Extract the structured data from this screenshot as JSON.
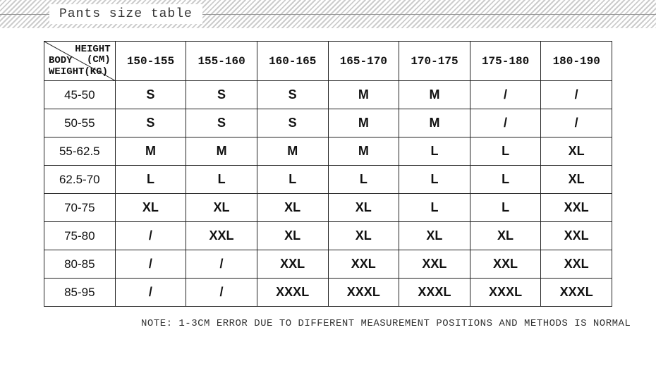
{
  "title": "Pants size table",
  "corner": {
    "top1": "HEIGHT",
    "top2": "(CM)",
    "bot1": "BODY",
    "bot2": "WEIGHT(KG)"
  },
  "chart_data": {
    "type": "table",
    "title": "Pants size table",
    "xlabel": "HEIGHT (CM)",
    "ylabel": "BODY WEIGHT (KG)",
    "categories": [
      "150-155",
      "155-160",
      "160-165",
      "165-170",
      "170-175",
      "175-180",
      "180-190"
    ],
    "rows": [
      {
        "label": "45-50",
        "values": [
          "S",
          "S",
          "S",
          "M",
          "M",
          "/",
          "/"
        ]
      },
      {
        "label": "50-55",
        "values": [
          "S",
          "S",
          "S",
          "M",
          "M",
          "/",
          "/"
        ]
      },
      {
        "label": "55-62.5",
        "values": [
          "M",
          "M",
          "M",
          "M",
          "L",
          "L",
          "XL"
        ]
      },
      {
        "label": "62.5-70",
        "values": [
          "L",
          "L",
          "L",
          "L",
          "L",
          "L",
          "XL"
        ]
      },
      {
        "label": "70-75",
        "values": [
          "XL",
          "XL",
          "XL",
          "XL",
          "L",
          "L",
          "XXL"
        ]
      },
      {
        "label": "75-80",
        "values": [
          "/",
          "XXL",
          "XL",
          "XL",
          "XL",
          "XL",
          "XXL"
        ]
      },
      {
        "label": "80-85",
        "values": [
          "/",
          "/",
          "XXL",
          "XXL",
          "XXL",
          "XXL",
          "XXL"
        ]
      },
      {
        "label": "85-95",
        "values": [
          "/",
          "/",
          "XXXL",
          "XXXL",
          "XXXL",
          "XXXL",
          "XXXL"
        ]
      }
    ]
  },
  "note": "NOTE: 1-3CM ERROR DUE TO DIFFERENT MEASUREMENT POSITIONS AND METHODS IS NORMAL"
}
